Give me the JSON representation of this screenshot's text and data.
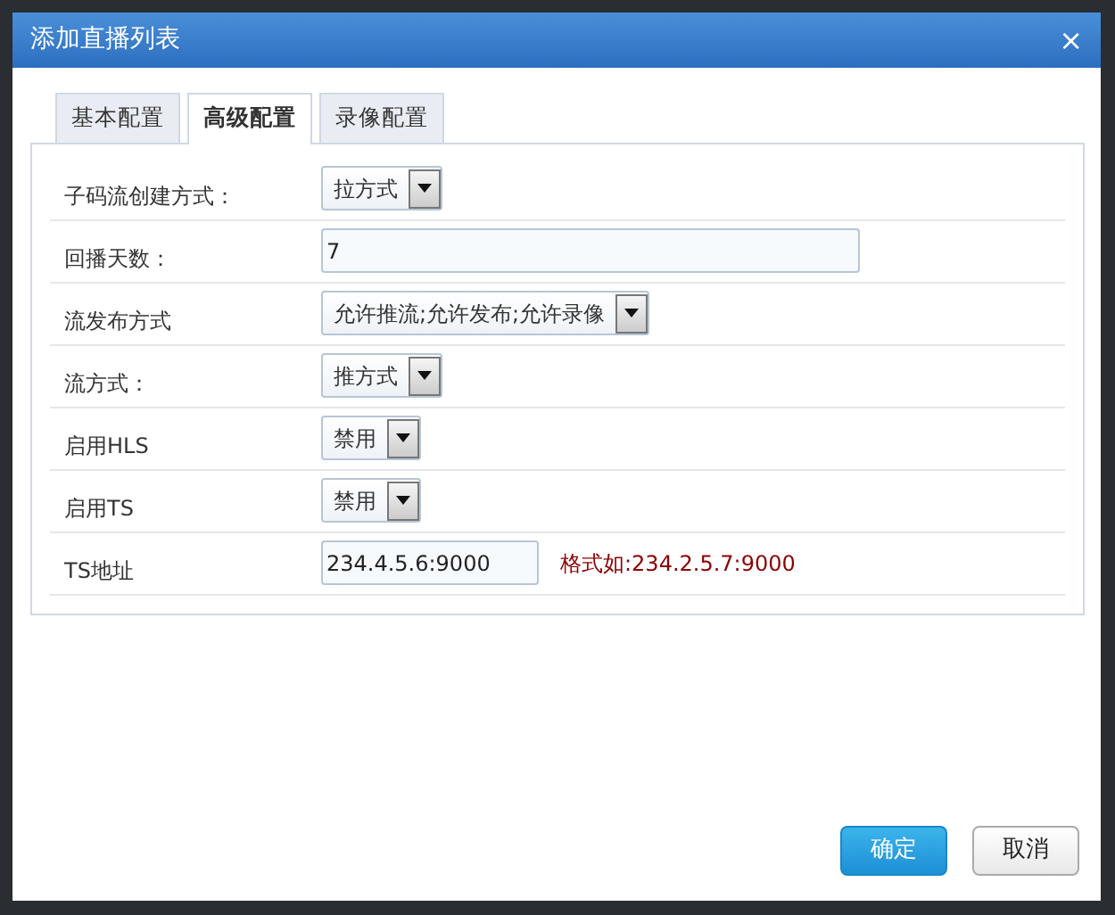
{
  "window": {
    "title": "添加直播列表",
    "close": "×"
  },
  "tabs": [
    {
      "label": "基本配置",
      "selected": false
    },
    {
      "label": "高级配置",
      "selected": true
    },
    {
      "label": "录像配置",
      "selected": false
    }
  ],
  "fields": [
    {
      "label": "子码流创建方式：",
      "kind": "select",
      "value": "拉方式"
    },
    {
      "label": "回播天数：",
      "kind": "text",
      "value": "7"
    },
    {
      "label": "流发布方式",
      "kind": "select",
      "value": "允许推流;允许发布;允许录像"
    },
    {
      "label": "流方式：",
      "kind": "select",
      "value": "推方式"
    },
    {
      "label": "启用HLS",
      "kind": "select",
      "value": "禁用"
    },
    {
      "label": "启用TS",
      "kind": "select",
      "value": "禁用"
    },
    {
      "label": "TS地址",
      "kind": "text",
      "value": "234.4.5.6:9000",
      "hint": "格式如:234.2.5.7:9000"
    }
  ],
  "buttons": [
    {
      "label": "确定",
      "kind": "primary"
    },
    {
      "label": "取消",
      "kind": "secondary"
    }
  ]
}
